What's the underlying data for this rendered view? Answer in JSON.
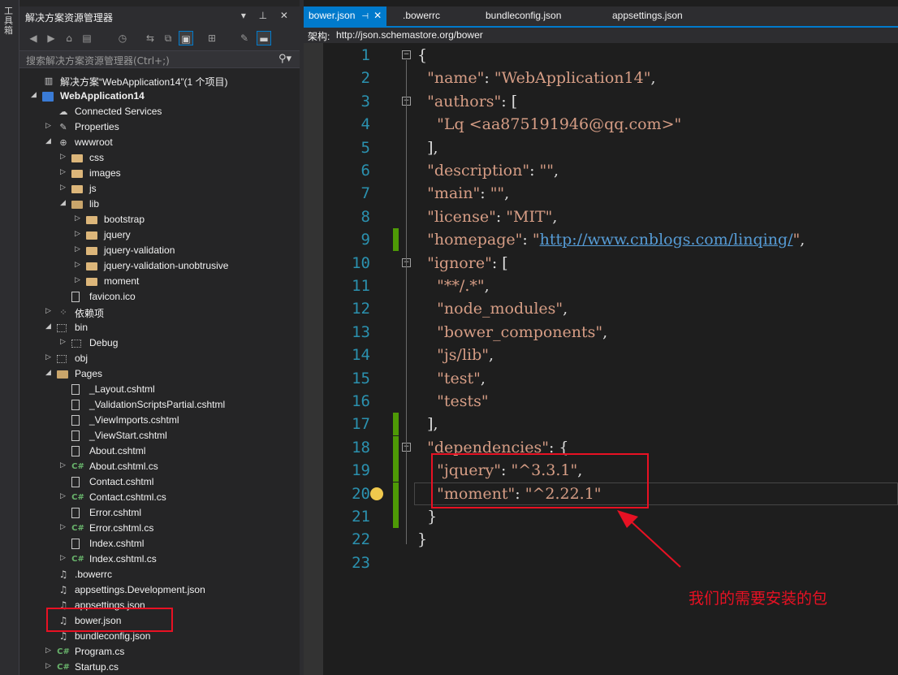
{
  "toolbox": {
    "label": "工具箱"
  },
  "explorer": {
    "title": "解决方案资源管理器",
    "title_controls": "▾ ⊥ ✕",
    "search_placeholder": "搜索解决方案资源管理器(Ctrl+;)",
    "items": [
      {
        "label": "解决方案“WebApplication14”(1 个项目)",
        "icon": "solution-icon",
        "indent": 0,
        "arrow": ""
      },
      {
        "label": "WebApplication14",
        "icon": "project-icon",
        "indent": 0,
        "arrow": "◢",
        "bold": true
      },
      {
        "label": "Connected Services",
        "icon": "connected-services-icon",
        "indent": 1,
        "arrow": ""
      },
      {
        "label": "Properties",
        "icon": "wrench-icon",
        "indent": 1,
        "arrow": "▷"
      },
      {
        "label": "wwwroot",
        "icon": "globe-icon",
        "indent": 1,
        "arrow": "◢"
      },
      {
        "label": "css",
        "icon": "folder-icon",
        "indent": 2,
        "arrow": "▷"
      },
      {
        "label": "images",
        "icon": "folder-icon",
        "indent": 2,
        "arrow": "▷"
      },
      {
        "label": "js",
        "icon": "folder-icon",
        "indent": 2,
        "arrow": "▷"
      },
      {
        "label": "lib",
        "icon": "folder-open-icon",
        "indent": 2,
        "arrow": "◢"
      },
      {
        "label": "bootstrap",
        "icon": "folder-icon",
        "indent": 3,
        "arrow": "▷"
      },
      {
        "label": "jquery",
        "icon": "folder-icon",
        "indent": 3,
        "arrow": "▷"
      },
      {
        "label": "jquery-validation",
        "icon": "folder-icon",
        "indent": 3,
        "arrow": "▷"
      },
      {
        "label": "jquery-validation-unobtrusive",
        "icon": "folder-icon",
        "indent": 3,
        "arrow": "▷"
      },
      {
        "label": "moment",
        "icon": "folder-icon",
        "indent": 3,
        "arrow": "▷"
      },
      {
        "label": "favicon.ico",
        "icon": "file-icon",
        "indent": 2,
        "arrow": ""
      },
      {
        "label": "依赖项",
        "icon": "dependencies-icon",
        "indent": 1,
        "arrow": "▷"
      },
      {
        "label": "bin",
        "icon": "dotted-folder-icon",
        "indent": 1,
        "arrow": "◢"
      },
      {
        "label": "Debug",
        "icon": "dotted-folder-icon",
        "indent": 2,
        "arrow": "▷"
      },
      {
        "label": "obj",
        "icon": "dotted-folder-icon",
        "indent": 1,
        "arrow": "▷"
      },
      {
        "label": "Pages",
        "icon": "folder-open-icon",
        "indent": 1,
        "arrow": "◢"
      },
      {
        "label": "_Layout.cshtml",
        "icon": "file-icon",
        "indent": 2,
        "arrow": ""
      },
      {
        "label": "_ValidationScriptsPartial.cshtml",
        "icon": "file-icon",
        "indent": 2,
        "arrow": ""
      },
      {
        "label": "_ViewImports.cshtml",
        "icon": "file-icon",
        "indent": 2,
        "arrow": ""
      },
      {
        "label": "_ViewStart.cshtml",
        "icon": "file-icon",
        "indent": 2,
        "arrow": ""
      },
      {
        "label": "About.cshtml",
        "icon": "file-icon",
        "indent": 2,
        "arrow": ""
      },
      {
        "label": "About.cshtml.cs",
        "icon": "csharp-icon",
        "indent": 2,
        "arrow": "▷"
      },
      {
        "label": "Contact.cshtml",
        "icon": "file-icon",
        "indent": 2,
        "arrow": ""
      },
      {
        "label": "Contact.cshtml.cs",
        "icon": "csharp-icon",
        "indent": 2,
        "arrow": "▷"
      },
      {
        "label": "Error.cshtml",
        "icon": "file-icon",
        "indent": 2,
        "arrow": ""
      },
      {
        "label": "Error.cshtml.cs",
        "icon": "csharp-icon",
        "indent": 2,
        "arrow": "▷"
      },
      {
        "label": "Index.cshtml",
        "icon": "file-icon",
        "indent": 2,
        "arrow": ""
      },
      {
        "label": "Index.cshtml.cs",
        "icon": "csharp-icon",
        "indent": 2,
        "arrow": "▷"
      },
      {
        "label": ".bowerrc",
        "icon": "json-file-icon",
        "indent": 1,
        "arrow": ""
      },
      {
        "label": "appsettings.Development.json",
        "icon": "json-file-icon",
        "indent": 1,
        "arrow": ""
      },
      {
        "label": "appsettings.json",
        "icon": "json-file-icon",
        "indent": 1,
        "arrow": ""
      },
      {
        "label": "bower.json",
        "icon": "json-file-icon",
        "indent": 1,
        "arrow": ""
      },
      {
        "label": "bundleconfig.json",
        "icon": "json-file-icon",
        "indent": 1,
        "arrow": ""
      },
      {
        "label": "Program.cs",
        "icon": "csharp-icon",
        "indent": 1,
        "arrow": "▷"
      },
      {
        "label": "Startup.cs",
        "icon": "csharp-icon",
        "indent": 1,
        "arrow": "▷"
      }
    ]
  },
  "editor": {
    "tabs": [
      {
        "label": "bower.json",
        "active": true
      },
      {
        "label": ".bowerrc",
        "active": false
      },
      {
        "label": "bundleconfig.json",
        "active": false
      },
      {
        "label": "appsettings.json",
        "active": false
      }
    ],
    "schema_label": "架构:",
    "schema_url": "http://json.schemastore.org/bower",
    "lines": [
      {
        "n": "1",
        "html": "<span class='p'>{</span>"
      },
      {
        "n": "2",
        "html": "  <span class='k'>\"name\"</span><span class='p'>: </span><span class='s'>\"WebApplication14\"</span><span class='p'>,</span>"
      },
      {
        "n": "3",
        "html": "  <span class='k'>\"authors\"</span><span class='p'>: [</span>"
      },
      {
        "n": "4",
        "html": "    <span class='s'>\"Lq &lt;aa875191946@qq.com&gt;\"</span>"
      },
      {
        "n": "5",
        "html": "  <span class='p'>],</span>"
      },
      {
        "n": "6",
        "html": "  <span class='k'>\"description\"</span><span class='p'>: </span><span class='s'>\"\"</span><span class='p'>,</span>"
      },
      {
        "n": "7",
        "html": "  <span class='k'>\"main\"</span><span class='p'>: </span><span class='s'>\"\"</span><span class='p'>,</span>"
      },
      {
        "n": "8",
        "html": "  <span class='k'>\"license\"</span><span class='p'>: </span><span class='s'>\"MIT\"</span><span class='p'>,</span>"
      },
      {
        "n": "9",
        "html": "  <span class='k'>\"homepage\"</span><span class='p'>: </span><span class='s'>\"</span><span class='url'>http://www.cnblogs.com/linqing/</span><span class='s'>\"</span><span class='p'>,</span>"
      },
      {
        "n": "10",
        "html": "  <span class='k'>\"ignore\"</span><span class='p'>: [</span>"
      },
      {
        "n": "11",
        "html": "    <span class='s'>\"**/.*\"</span><span class='p'>,</span>"
      },
      {
        "n": "12",
        "html": "    <span class='s'>\"node_modules\"</span><span class='p'>,</span>"
      },
      {
        "n": "13",
        "html": "    <span class='s'>\"bower_components\"</span><span class='p'>,</span>"
      },
      {
        "n": "14",
        "html": "    <span class='s'>\"js/lib\"</span><span class='p'>,</span>"
      },
      {
        "n": "15",
        "html": "    <span class='s'>\"test\"</span><span class='p'>,</span>"
      },
      {
        "n": "16",
        "html": "    <span class='s'>\"tests\"</span>"
      },
      {
        "n": "17",
        "html": "  <span class='p'>],</span>"
      },
      {
        "n": "18",
        "html": "  <span class='k'>\"dependencies\"</span><span class='p'>: {</span>"
      },
      {
        "n": "19",
        "html": "    <span class='k'>\"jquery\"</span><span class='p'>: </span><span class='s'>\"^3.3.1\"</span><span class='p'>,</span>"
      },
      {
        "n": "20",
        "html": "    <span class='k'>\"moment\"</span><span class='p'>: </span><span class='s'>\"^2.22.1\"</span>"
      },
      {
        "n": "21",
        "html": "  <span class='p'>}</span>"
      },
      {
        "n": "22",
        "html": "<span class='p'>}</span>"
      },
      {
        "n": "23",
        "html": ""
      }
    ]
  },
  "annotation": "我们的需要安装的包",
  "colors": {
    "accent": "#007acc",
    "highlight": "#e81123",
    "change": "#4e9a06"
  }
}
